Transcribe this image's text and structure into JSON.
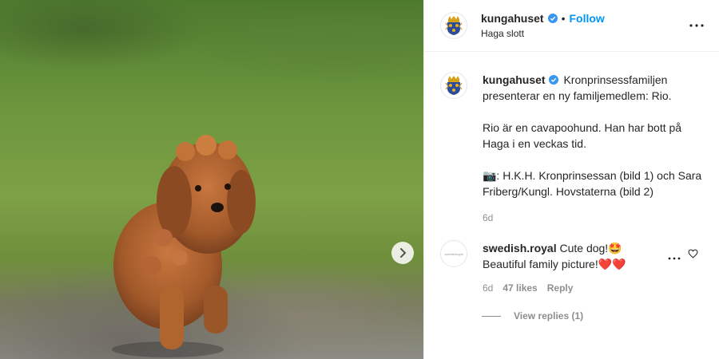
{
  "post": {
    "username": "kungahuset",
    "follow_label": "Follow",
    "location": "Haga slott",
    "separator": "•",
    "caption": {
      "line1": "Kronprinsessfamiljen presenterar en ny familjemedlem: Rio.",
      "line2": "Rio är en cavapoohund. Han har bott på Haga i en veckas tid.",
      "line3": "📷: H.K.H. Kronprinsessan (bild 1) och Sara Friberg/Kungl. Hovstaterna (bild 2)"
    },
    "time": "6d"
  },
  "comment": {
    "username": "swedish.royal",
    "avatar_text": "swedishroyal",
    "text": "Cute dog!🤩 Beautiful family picture!",
    "hearts": "❤️❤️",
    "time": "6d",
    "likes": "47 likes",
    "reply_label": "Reply",
    "view_replies": "View replies (1)"
  },
  "icons": {
    "next": "chevron-right-icon",
    "more": "more-horizontal-icon",
    "verified": "verified-badge-icon",
    "heart": "heart-outline-icon"
  },
  "colors": {
    "accent": "#0095f6",
    "verified": "#3897f0",
    "secondary_text": "#8e8e8e"
  }
}
